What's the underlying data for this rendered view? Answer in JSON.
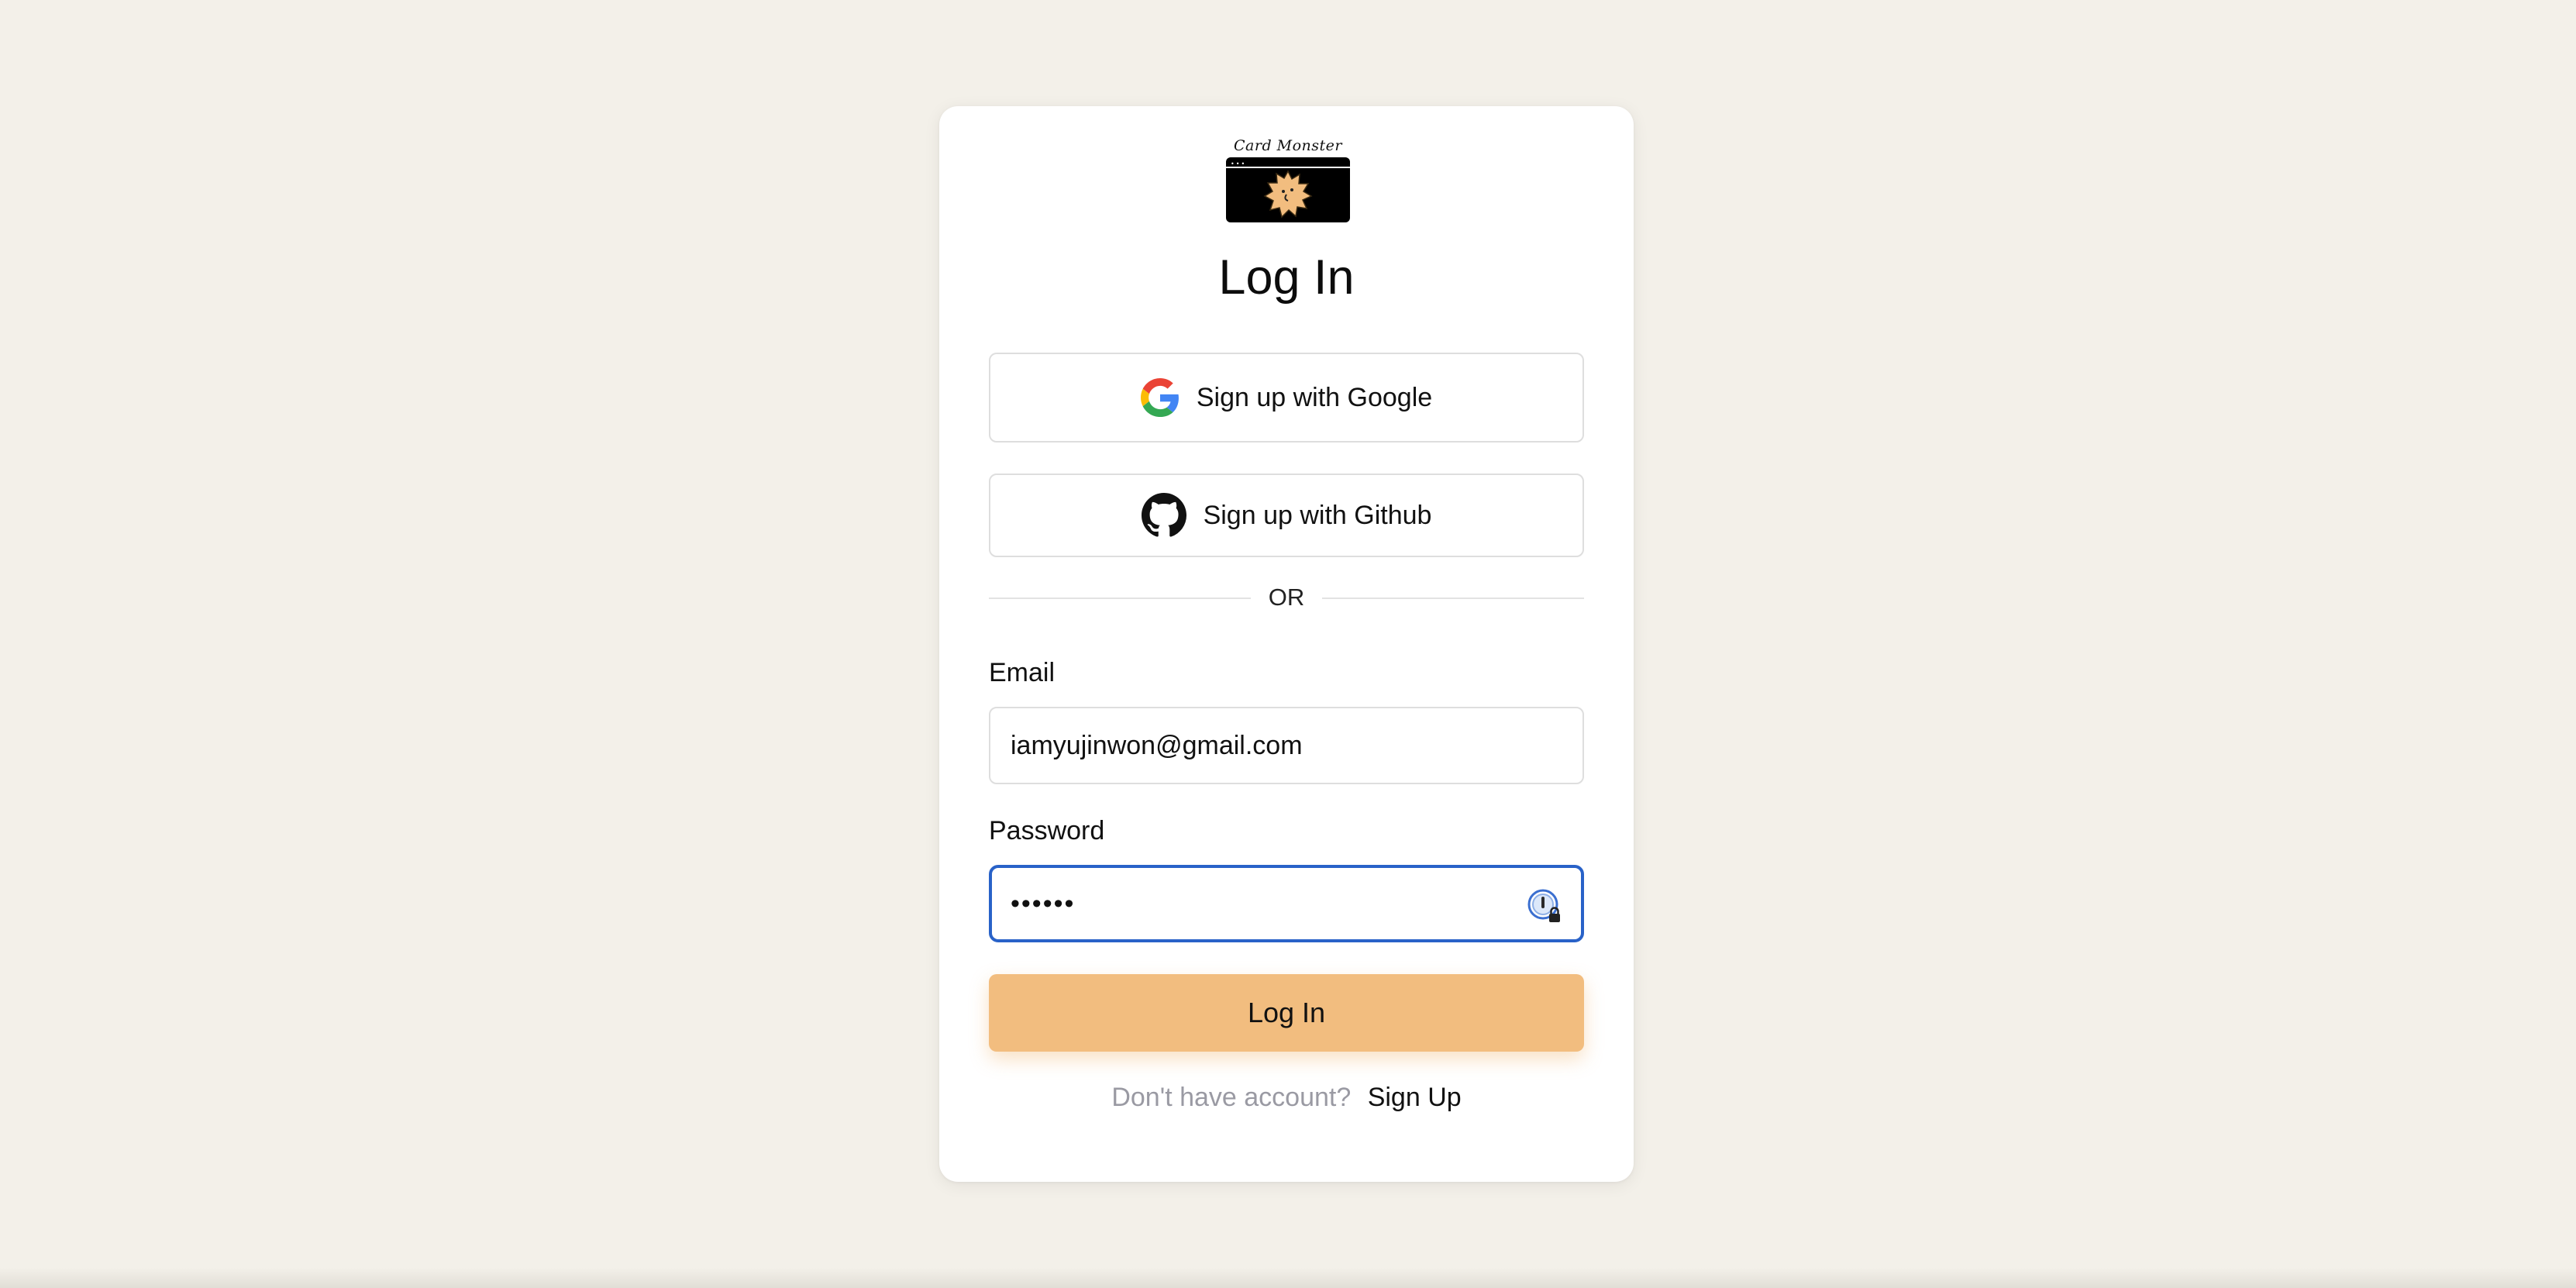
{
  "logo": {
    "text": "Card Monster"
  },
  "title": "Log In",
  "oauth": {
    "google_label": "Sign up with Google",
    "github_label": "Sign up with Github"
  },
  "divider": {
    "text": "OR"
  },
  "email": {
    "label": "Email",
    "value": "iamyujinwon@gmail.com"
  },
  "password": {
    "label": "Password",
    "value": "••••••"
  },
  "login_button": "Log In",
  "signup": {
    "question": "Don't have account?",
    "link": "Sign Up"
  },
  "colors": {
    "background": "#f3f0e9",
    "accent": "#f2bd7f",
    "focus_border": "#2962c8",
    "muted_text": "#9a9aa3"
  },
  "icons": [
    "google-icon",
    "github-icon",
    "password-manager-icon"
  ]
}
